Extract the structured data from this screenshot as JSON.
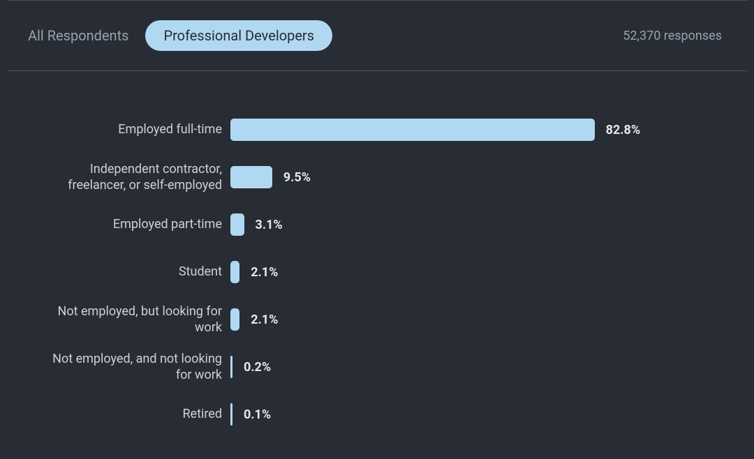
{
  "tabs": {
    "all": "All Respondents",
    "pro": "Professional Developers",
    "active": "pro"
  },
  "responses": "52,370 responses",
  "colors": {
    "bar": "#b1d8f1",
    "bg": "#272c35"
  },
  "chart_data": {
    "type": "bar",
    "orientation": "horizontal",
    "title": "",
    "xlabel": "",
    "ylabel": "",
    "xlim": [
      0,
      100
    ],
    "unit": "%",
    "categories": [
      "Employed full-time",
      "Independent contractor, freelancer, or self-employed",
      "Employed part-time",
      "Student",
      "Not employed, but looking for work",
      "Not employed, and not looking for work",
      "Retired"
    ],
    "values": [
      82.8,
      9.5,
      3.1,
      2.1,
      2.1,
      0.2,
      0.1
    ],
    "value_labels": [
      "82.8%",
      "9.5%",
      "3.1%",
      "2.1%",
      "2.1%",
      "0.2%",
      "0.1%"
    ]
  }
}
